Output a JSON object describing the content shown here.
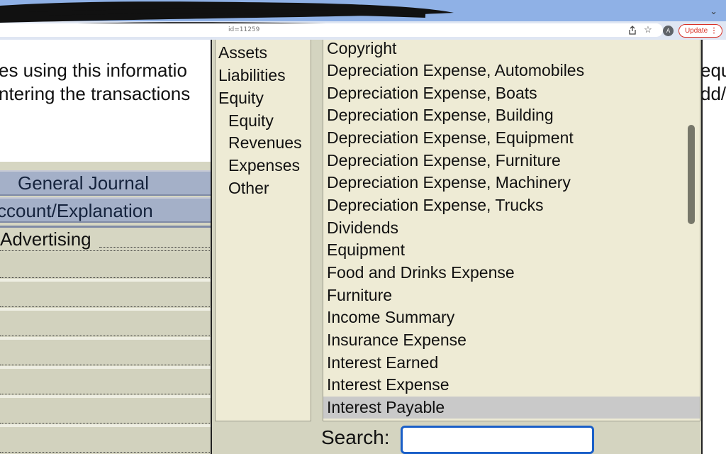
{
  "browser": {
    "url_fragment": "id=11259",
    "tab_chevron": "⌄",
    "avatar_letter": "A",
    "update_label": "Update",
    "menu_glyph": "⋮",
    "icons": [
      "share-icon",
      "star-icon",
      "chevron-down-icon",
      "kebab-menu-icon"
    ]
  },
  "instructions": {
    "line1": "es using this informatio",
    "line2": "ntering the transactions",
    "line1_right": "equ",
    "line2_right": "dd/"
  },
  "journal": {
    "title": "General Journal",
    "column_header": "ccount/Explanation",
    "first_entry": "Advertising"
  },
  "categories": [
    {
      "label": "Assets",
      "indent": false
    },
    {
      "label": "Liabilities",
      "indent": false
    },
    {
      "label": "Equity",
      "indent": false
    },
    {
      "label": "Equity",
      "indent": true
    },
    {
      "label": "Revenues",
      "indent": true
    },
    {
      "label": "Expenses",
      "indent": true
    },
    {
      "label": "Other",
      "indent": true
    }
  ],
  "accounts": [
    "Copyright",
    "Depreciation Expense, Automobiles",
    "Depreciation Expense, Boats",
    "Depreciation Expense, Building",
    "Depreciation Expense, Equipment",
    "Depreciation Expense, Furniture",
    "Depreciation Expense, Machinery",
    "Depreciation Expense, Trucks",
    "Dividends",
    "Equipment",
    "Food and Drinks Expense",
    "Furniture",
    "Income Summary",
    "Insurance Expense",
    "Interest Earned",
    "Interest Expense",
    "Interest Payable"
  ],
  "selected_account": "Interest Payable",
  "search": {
    "label": "Search:",
    "value": ""
  },
  "colors": {
    "tabstrip": "#8fb1e6",
    "journal_header": "#a4b0c8",
    "panel_bg": "#eeebd5",
    "selected_row": "#c9c9c9",
    "search_border": "#1a5fc8",
    "update_red": "#d93025"
  }
}
